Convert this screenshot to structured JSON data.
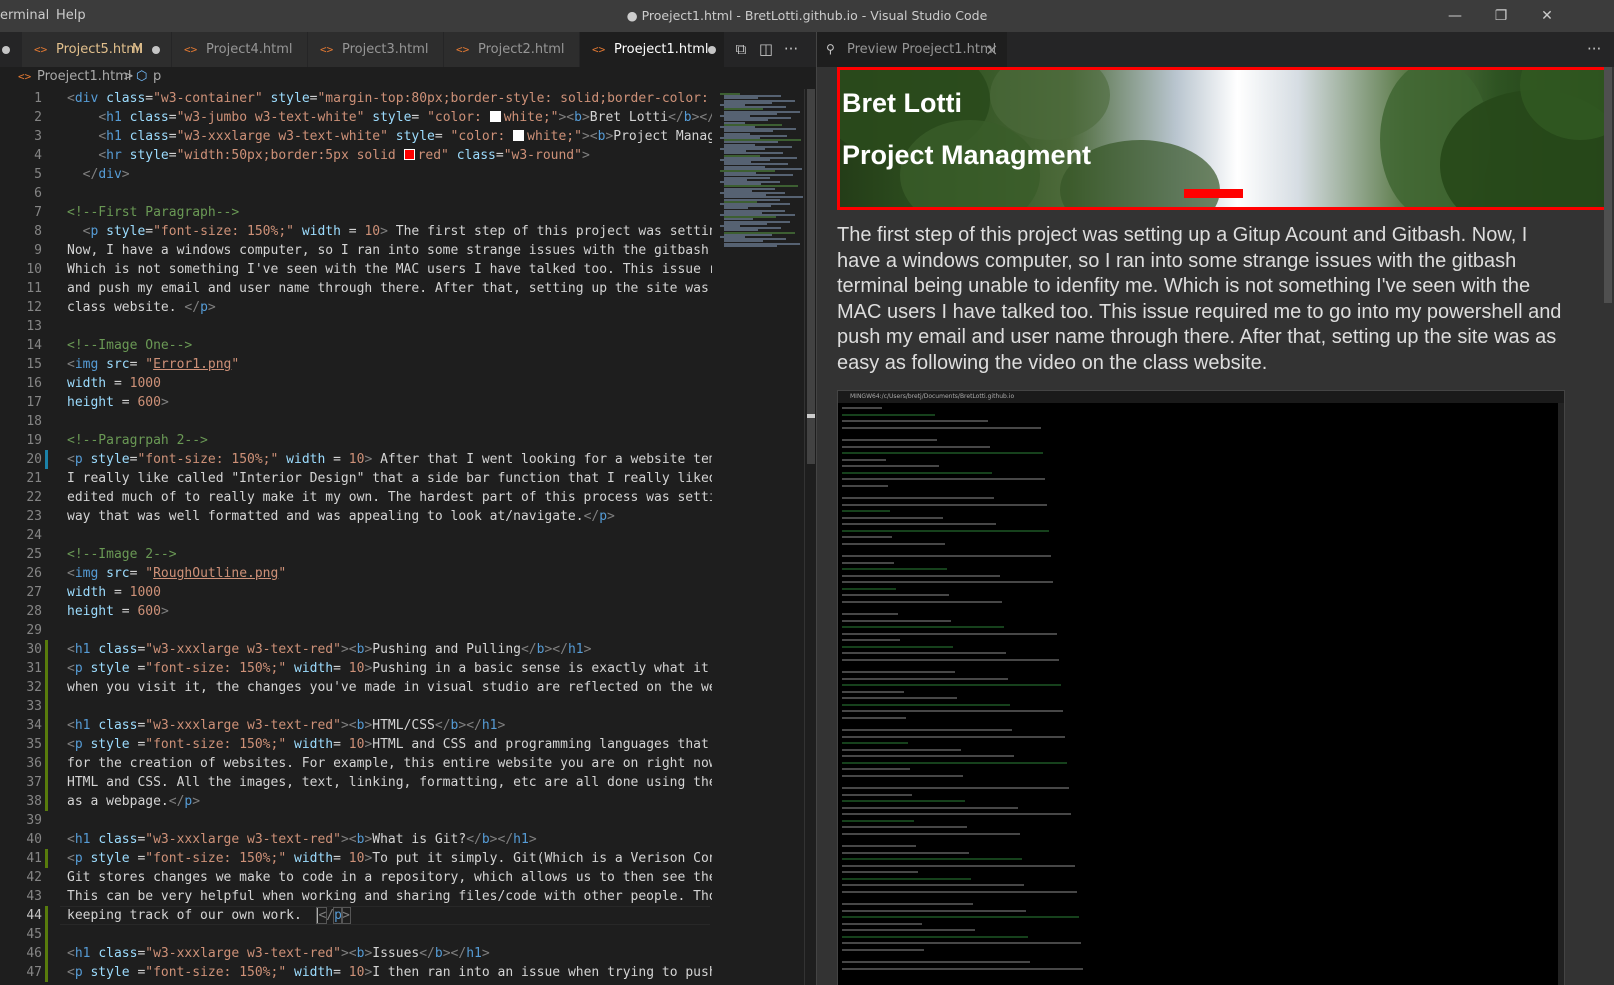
{
  "window": {
    "title": "● Proeject1.html - BretLotti.github.io - Visual Studio Code",
    "menu": [
      "erminal",
      "Help"
    ],
    "controls": {
      "minimize": "—",
      "maximize": "❐",
      "close": "✕"
    }
  },
  "editor_tabs": [
    {
      "label": "Project5.html",
      "badge": "M",
      "state": "modified-dot"
    },
    {
      "label": "Project4.html",
      "state": "normal"
    },
    {
      "label": "Project3.html",
      "state": "normal"
    },
    {
      "label": "Project2.html",
      "state": "normal"
    },
    {
      "label": "Proeject1.html",
      "state": "active-dirty"
    }
  ],
  "tab_actions": {
    "split_preview": "⧉",
    "split_editor": "◫",
    "more": "···"
  },
  "breadcrumb": {
    "file": "Proeject1.html",
    "separator": ">",
    "symbol": "p"
  },
  "preview_tab": {
    "label": "Preview Proeject1.html",
    "close": "×",
    "more": "···"
  },
  "gutter": {
    "line_numbers": [
      "1",
      "2",
      "3",
      "4",
      "5",
      "6",
      "7",
      "8",
      "9",
      "10",
      "11",
      "12",
      "13",
      "14",
      "15",
      "16",
      "17",
      "18",
      "19",
      "20",
      "21",
      "22",
      "23",
      "24",
      "25",
      "26",
      "27",
      "28",
      "29",
      "30",
      "31",
      "32",
      "33",
      "34",
      "35",
      "36",
      "37",
      "38",
      "39",
      "40",
      "41",
      "42",
      "43",
      "44",
      "45",
      "46",
      "47"
    ],
    "current_line": "44"
  },
  "preview": {
    "heading1": "Bret Lotti",
    "heading2": "Project Managment",
    "paragraph": "The first step of this project was setting up a Gitup Acount and Gitbash. Now, I have a windows computer, so I ran into some strange issues with the gitbash terminal being unable to idenfity me. Which is not something I've seen with the MAC users I have talked too. This issue required me to go into my powershell and push my email and user name through there. After that, setting up the site was as easy as following the video on the class website.",
    "terminal_title": "MINGW64:/c/Users/bretj/Documents/BretLotti.github.io"
  },
  "colors": {
    "keyword": "#569cd6",
    "attribute": "#9cdcfe",
    "string": "#ce9178",
    "comment": "#6a9955",
    "banner_border": "#ff0000",
    "preview_bg": "#333333",
    "modified_tab": "#e2c08d"
  }
}
